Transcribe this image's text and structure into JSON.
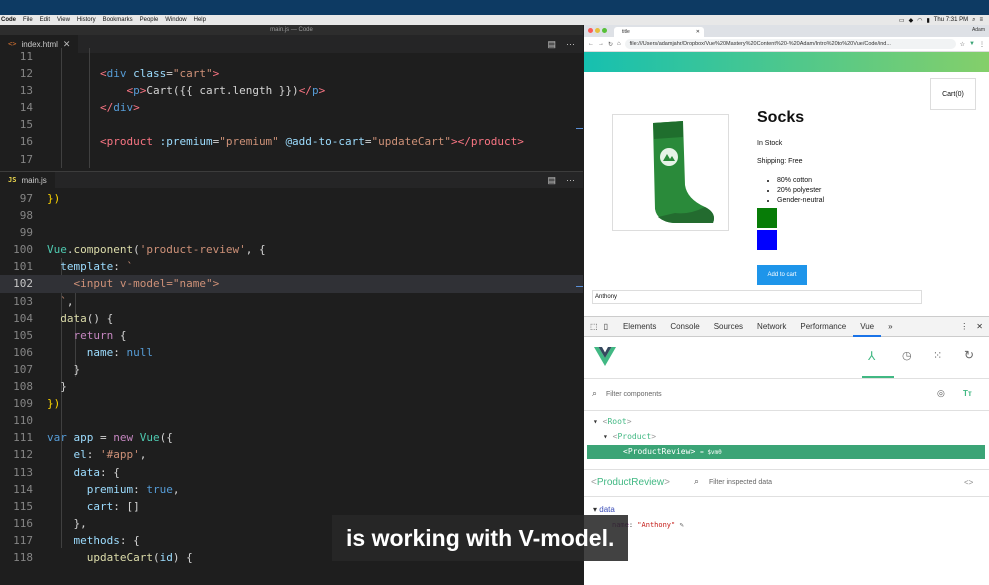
{
  "menubar": {
    "app": "Code",
    "items": [
      "File",
      "Edit",
      "View",
      "History",
      "Bookmarks",
      "People",
      "Window",
      "Help"
    ],
    "clock": "Thu 7:31 PM"
  },
  "window_title": "main.js — Code",
  "editor_top": {
    "tab": "index.html",
    "lines": [
      "11",
      "12",
      "13",
      "14",
      "15",
      "16",
      "17"
    ]
  },
  "editor_bottom": {
    "tab": "main.js",
    "lines": [
      "97",
      "98",
      "99",
      "100",
      "101",
      "102",
      "103",
      "104",
      "105",
      "106",
      "107",
      "108",
      "109",
      "110",
      "111",
      "112",
      "113",
      "114",
      "115",
      "116",
      "117",
      "118"
    ]
  },
  "browser": {
    "tab_title": "title",
    "profile": "Adam",
    "url": "file:///Users/adamjahr/Dropbox/Vue%20Mastery%20Content%20-%20Adam/Intro%20to%20Vue/Code/ind...",
    "cart_label": "Cart(0)",
    "product_title": "Socks",
    "stock": "In Stock",
    "shipping": "Shipping: Free",
    "details": [
      "80% cotton",
      "20% polyester",
      "Gender-neutral"
    ],
    "add_to_cart": "Add to cart",
    "review_input_value": "Anthony",
    "colors": {
      "green": "#077c07",
      "blue": "#0000ff",
      "button": "#1e95ea"
    }
  },
  "devtools": {
    "tabs": [
      "Elements",
      "Console",
      "Sources",
      "Network",
      "Performance",
      "Vue"
    ],
    "filter_placeholder": "Filter components",
    "tree": {
      "root": "Root",
      "product": "Product",
      "review": "ProductReview",
      "review_ref": "= $vm0"
    },
    "inspected_name": "ProductReview",
    "inspected_filter_placeholder": "Filter inspected data",
    "data_section": "data",
    "data_key": "name",
    "data_value": "\"Anthony\""
  },
  "caption": "is working with V-model."
}
